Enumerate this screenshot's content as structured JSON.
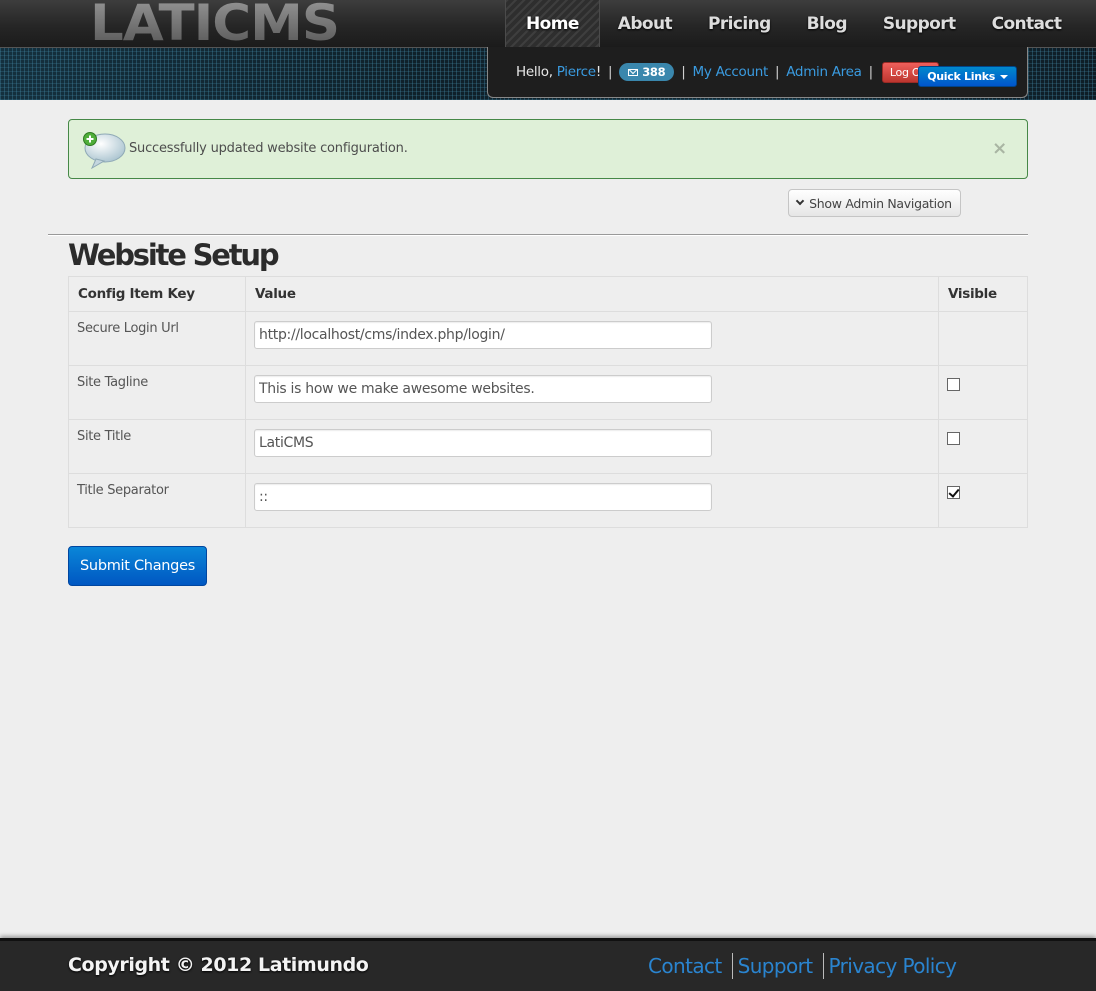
{
  "header": {
    "logo_text": "LATICMS",
    "nav": [
      {
        "label": "Home",
        "active": true
      },
      {
        "label": "About",
        "active": false
      },
      {
        "label": "Pricing",
        "active": false
      },
      {
        "label": "Blog",
        "active": false
      },
      {
        "label": "Support",
        "active": false
      },
      {
        "label": "Contact",
        "active": false
      }
    ],
    "userbar": {
      "greeting": "Hello,",
      "username": "Pierce",
      "greeting_suffix": "!",
      "message_count": "388",
      "my_account": "My Account",
      "admin_area": "Admin Area",
      "logout": "Log Out",
      "quick_links": "Quick Links",
      "separator": "|"
    }
  },
  "alert": {
    "message": "Successfully updated website configuration.",
    "close": "×"
  },
  "admin_nav_button": "Show Admin Navigation",
  "page": {
    "title": "Website Setup"
  },
  "table": {
    "headers": {
      "key": "Config Item Key",
      "value": "Value",
      "visible": "Visible"
    },
    "rows": [
      {
        "key": "Secure Login Url",
        "value": "http://localhost/cms/index.php/login/",
        "has_checkbox": false,
        "visible": false
      },
      {
        "key": "Site Tagline",
        "value": "This is how we make awesome websites.",
        "has_checkbox": true,
        "visible": false
      },
      {
        "key": "Site Title",
        "value": "LatiCMS",
        "has_checkbox": true,
        "visible": false
      },
      {
        "key": "Title Separator",
        "value": "::",
        "has_checkbox": true,
        "visible": true
      }
    ]
  },
  "submit_label": "Submit Changes",
  "footer": {
    "copyright": "Copyright © 2012 Latimundo",
    "links": [
      "Contact",
      "Support",
      "Privacy Policy"
    ]
  },
  "colors": {
    "link_blue": "#3a9be0",
    "alert_bg": "#dff0d8",
    "alert_border": "#468847",
    "logout_red": "#bd362f",
    "primary_blue": "#0057c2",
    "badge_blue": "#3a87ad"
  },
  "icons": [
    "speech-bubble-add-icon",
    "envelope-icon",
    "caret-down-icon",
    "chevron-down-icon",
    "close-icon",
    "checkbox-icon"
  ]
}
